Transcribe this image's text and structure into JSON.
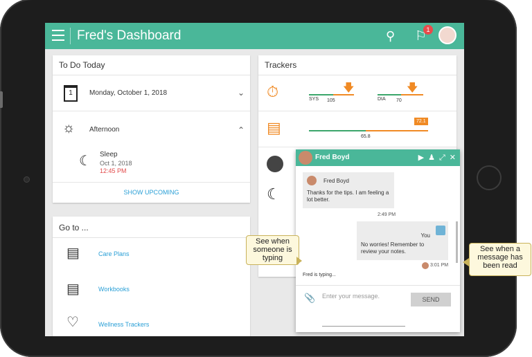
{
  "app": {
    "title": "Fred's Dashboard",
    "notification_count": "1"
  },
  "todo": {
    "header": "To Do Today",
    "date": "Monday, October 1, 2018",
    "calendar_day": "1",
    "period": "Afternoon",
    "item": {
      "title": "Sleep",
      "date": "Oct 1, 2018",
      "time": "12:45 PM"
    },
    "show_upcoming": "SHOW UPCOMING"
  },
  "goto": {
    "header": "Go to ...",
    "items": [
      {
        "label": "Care Plans",
        "icon": "map-icon"
      },
      {
        "label": "Workbooks",
        "icon": "book-icon"
      },
      {
        "label": "Wellness Trackers",
        "icon": "heart-check-icon"
      }
    ]
  },
  "trackers": {
    "header": "Trackers",
    "bp": {
      "sys_label": "SYS",
      "sys_value": "105",
      "dia_label": "DIA",
      "dia_value": "70"
    },
    "weight": {
      "value": "65.8",
      "badge": "72.1"
    }
  },
  "chat": {
    "name": "Fred Boyd",
    "incoming": {
      "sender": "Fred Boyd",
      "text": "Thanks for the tips. I am feeling a lot better.",
      "time": "2:49 PM"
    },
    "outgoing": {
      "sender": "You",
      "text": "No worries! Remember to review your notes.",
      "time": "3:01 PM"
    },
    "typing": "Fred is typing...",
    "placeholder": "Enter your message.",
    "send": "SEND"
  },
  "callouts": {
    "typing": "See when someone is typing",
    "read": "See when a message has been read"
  },
  "colors": {
    "accent": "#4ab799",
    "link": "#2a9fd6",
    "orange": "#f08a24",
    "alert": "#e94b4b"
  }
}
